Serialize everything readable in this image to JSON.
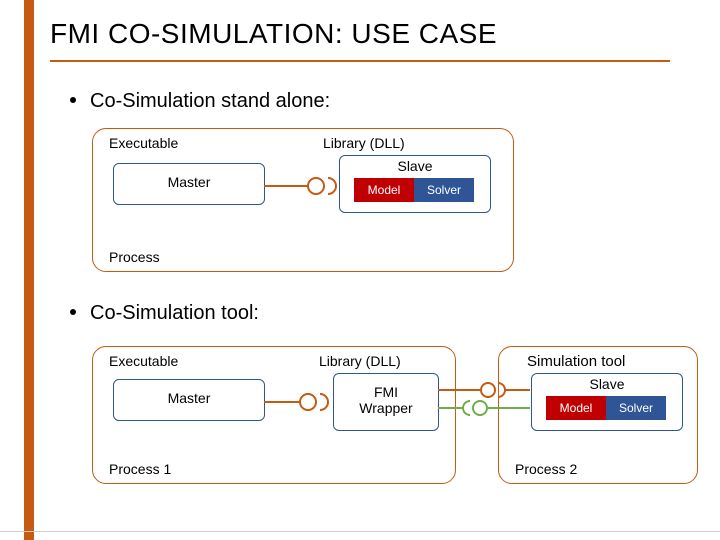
{
  "title": "FMI CO-SIMULATION: USE CASE",
  "bullet1": "Co-Simulation stand alone:",
  "bullet2": "Co-Simulation tool:",
  "labels": {
    "executable": "Executable",
    "library": "Library (DLL)",
    "master": "Master",
    "slave": "Slave",
    "model": "Model",
    "solver": "Solver",
    "fmi_wrapper": "FMI Wrapper",
    "sim_tool": "Simulation tool",
    "process": "Process",
    "process1": "Process 1",
    "process2": "Process 2"
  },
  "colors": {
    "accent": "#c55a11",
    "blue": "#2f5597",
    "red": "#c00000"
  }
}
